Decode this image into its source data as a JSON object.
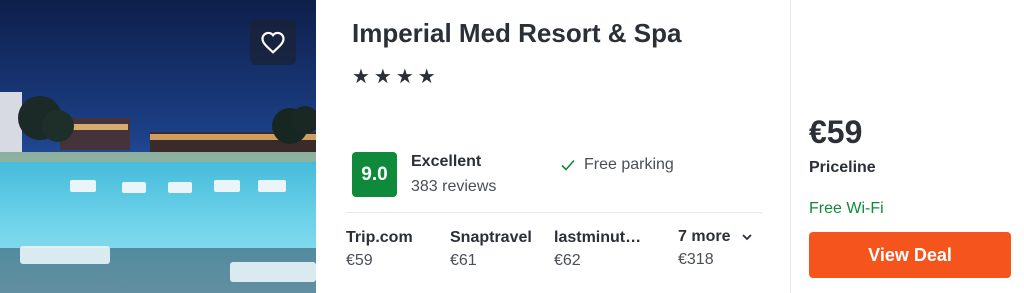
{
  "hotel": {
    "name": "Imperial Med Resort & Spa",
    "stars": "★★★★",
    "score": "9.0",
    "rating_word": "Excellent",
    "review_count": "383 reviews"
  },
  "amenity": {
    "label": "Free parking",
    "icon": "check-icon"
  },
  "providers": [
    {
      "name": "Trip.com",
      "price": "€59"
    },
    {
      "name": "Snaptravel",
      "price": "€61"
    },
    {
      "name": "lastminut…",
      "price": "€62"
    }
  ],
  "more": {
    "label": "7 more",
    "price": "€318",
    "icon": "chevron-down-icon"
  },
  "deal": {
    "price": "€59",
    "provider": "Priceline",
    "perk": "Free Wi-Fi",
    "button_label": "View Deal"
  },
  "colors": {
    "score_badge": "#0f8a3a",
    "perk_text": "#0f8a3a",
    "deal_button": "#f5541c",
    "favorite_button_bg": "#192337"
  },
  "icons": {
    "favorite": "heart-icon"
  }
}
